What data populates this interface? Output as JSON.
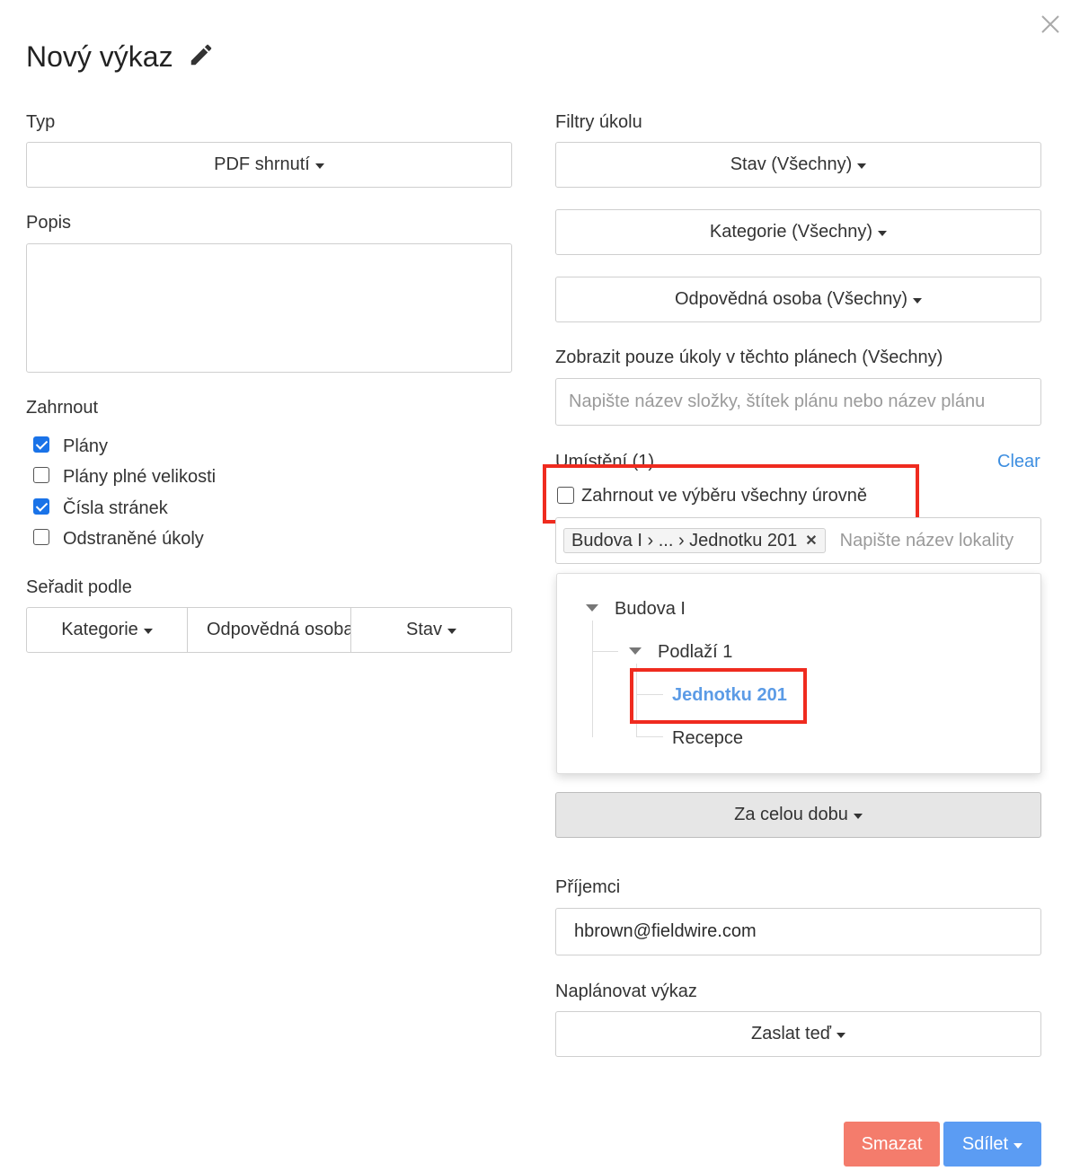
{
  "header": {
    "title": "Nový výkaz",
    "edit_icon": "pencil-icon",
    "close_icon": "close-icon"
  },
  "left": {
    "type_label": "Typ",
    "type_value": "PDF shrnutí",
    "description_label": "Popis",
    "description_value": "",
    "include_label": "Zahrnout",
    "include_options": [
      {
        "label": "Plány",
        "checked": true
      },
      {
        "label": "Plány plné velikosti",
        "checked": false
      },
      {
        "label": "Čísla stránek",
        "checked": true
      },
      {
        "label": "Odstraněné úkoly",
        "checked": false
      }
    ],
    "sort_label": "Seřadit podle",
    "sort_buttons": [
      "Kategorie",
      "Odpovědná osoba",
      "Stav"
    ]
  },
  "right": {
    "filters_label": "Filtry úkolu",
    "filter_status": "Stav (Všechny)",
    "filter_category": "Kategorie (Všechny)",
    "filter_assignee": "Odpovědná osoba (Všechny)",
    "plans_label": "Zobrazit pouze úkoly v těchto plánech (Všechny)",
    "plans_placeholder": "Napište název složky, štítek plánu nebo název plánu",
    "location_label": "Umístění (1)",
    "clear_label": "Clear",
    "include_all_levels_label": "Zahrnout ve výběru všechny úrovně",
    "include_all_levels_checked": false,
    "location_tag": "Budova I › ... › Jednotku 201",
    "location_placeholder": "Napište název lokality",
    "tree": {
      "root": "Budova I",
      "level": "Podlaží 1",
      "selected": "Jednotku 201",
      "other": "Recepce"
    },
    "date_range": "Za celou dobu",
    "recipients_label": "Příjemci",
    "recipients_value": "hbrown@fieldwire.com",
    "schedule_label": "Naplánovat výkaz",
    "schedule_value": "Zaslat teď"
  },
  "footer": {
    "delete_label": "Smazat",
    "share_label": "Sdílet"
  },
  "colors": {
    "accent": "#1a73e8",
    "link": "#3d8ee0",
    "selected_text": "#5b9be6",
    "annotation": "#ef2b1f",
    "delete": "#f47c6c",
    "share": "#5b9cf3"
  }
}
